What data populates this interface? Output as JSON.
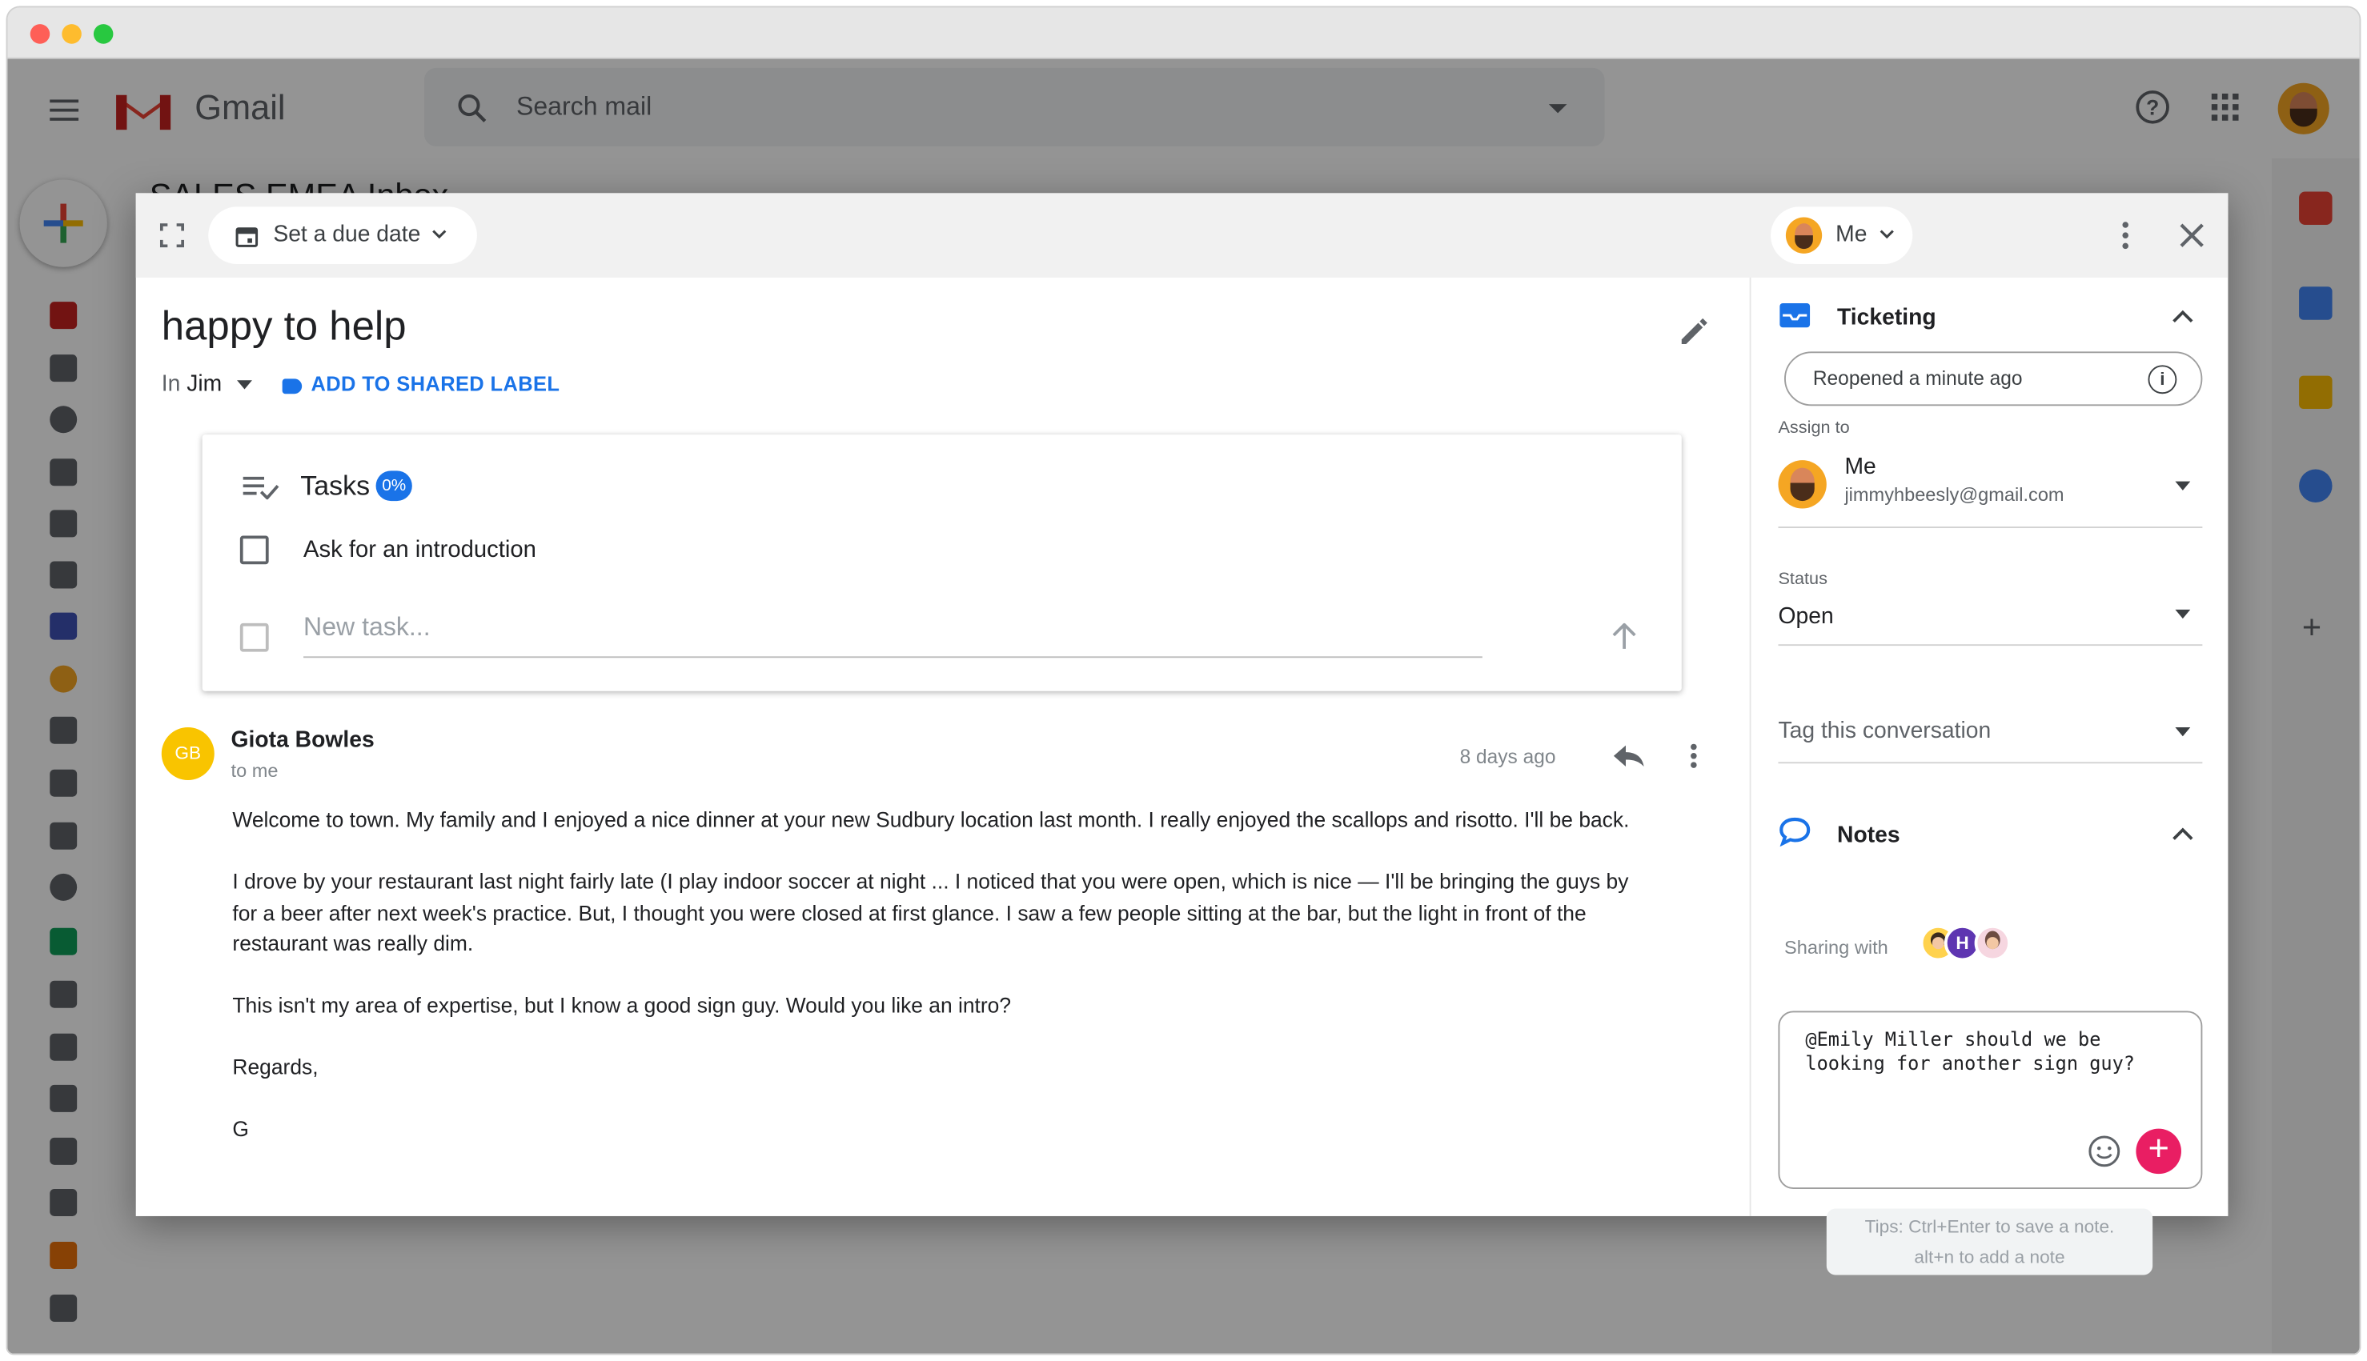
{
  "gmail": {
    "brand": "Gmail",
    "search_placeholder": "Search mail",
    "behind_title": "SALES EMEA Inbox"
  },
  "modal": {
    "due_date_label": "Set a due date",
    "assignee_pill": "Me",
    "subject": "happy to help",
    "in_label_prefix": "In",
    "in_label_name": "Jim",
    "add_shared_label": "ADD TO SHARED LABEL",
    "tasks": {
      "title": "Tasks",
      "progress": "0%",
      "items": [
        "Ask for an introduction"
      ],
      "new_task_placeholder": "New task..."
    },
    "message": {
      "sender_initials": "GB",
      "sender_name": "Giota Bowles",
      "to": "to me",
      "date": "8 days ago",
      "paragraphs": [
        "Welcome to town. My family and I enjoyed a nice dinner at your new Sudbury location last month. I really enjoyed the scallops and risotto. I'll be back.",
        "I drove by your restaurant last night fairly late (I play indoor soccer at night ... I noticed that you were open, which is nice — I'll be bringing the guys by for a beer after next week's practice. But, I thought you were closed at first glance. I saw a few people sitting at the bar, but the light in front of the restaurant was really dim.",
        "This isn't my area of expertise, but I know a good sign guy. Would you like an intro?",
        "Regards,",
        "G"
      ]
    }
  },
  "sidebar_panel": {
    "ticketing": {
      "title": "Ticketing",
      "reopened": "Reopened a minute ago",
      "assign_to_label": "Assign to",
      "assignee_name": "Me",
      "assignee_email": "jimmyhbeesly@gmail.com",
      "status_label": "Status",
      "status_value": "Open",
      "tag_placeholder": "Tag this conversation"
    },
    "notes": {
      "title": "Notes",
      "sharing_with": "Sharing with",
      "sharing_initial": "H",
      "note_text": "@Emily Miller should we be looking for another sign guy?",
      "tips_line1": "Tips: Ctrl+Enter to save a note.",
      "tips_line2": "alt+n to add a note"
    }
  },
  "colors": {
    "accent_blue": "#1a73e8",
    "pink_add": "#e91e63",
    "avatar_yellow": "#f9c400",
    "gmail_red": "#ea4335"
  }
}
